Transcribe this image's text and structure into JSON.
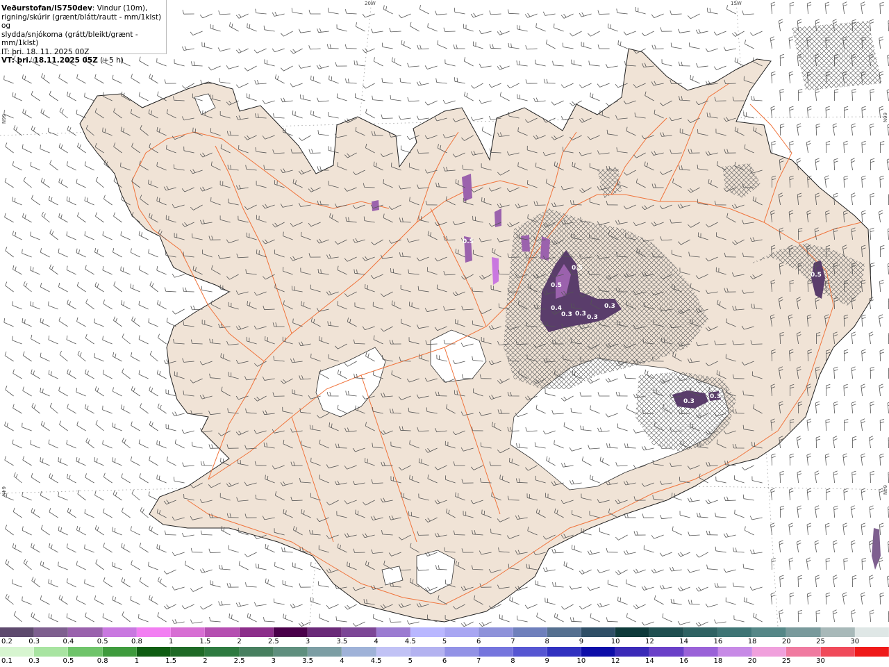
{
  "header": {
    "title": "Veðurstofan/IS750dev",
    "desc1": ": Vindur (10m),",
    "desc2": "rigning/skúrir (grænt/blátt/rautt - mm/1klst) og",
    "desc3": "slydda/snjókoma (grátt/bleikt/grænt - mm/1klst)",
    "it": "IT: þri. 18. 11. 2025 00Z",
    "vt_label": "VT: þri. 18.11.2025 05Z",
    "vt_offset": " (+5 h)"
  },
  "grid_labels": {
    "lon_20w": "20W",
    "lon_15w": "15W",
    "lat_66n_left": "66N",
    "lat_66n_right": "66N",
    "lat_64n_left": "64N",
    "lat_64n_right": "64N"
  },
  "precip_labels": [
    "0.5",
    "0.5",
    "0.4",
    "0.3",
    "0.3",
    "0.3",
    "0.3",
    "0.5",
    "0.3",
    "0.3",
    "0.5"
  ],
  "colors": {
    "land": "#f0e3d6",
    "roads": "#f0743c",
    "coast": "#222222",
    "wind": "#555555",
    "precip_dark": "#5a3d6b",
    "precip_pink": "#e06ce6"
  },
  "snow_scale": {
    "labels": [
      "0.2",
      "0.3",
      "0.4",
      "0.5",
      "0.8",
      "1",
      "1.5",
      "2",
      "2.5",
      "3",
      "3.5",
      "4",
      "4.5",
      "5",
      "6",
      "7",
      "8",
      "9",
      "10",
      "12",
      "14",
      "16",
      "18",
      "20",
      "25",
      "30"
    ],
    "colors": [
      "#5e4a6e",
      "#7e5f8f",
      "#9a62ad",
      "#c978e0",
      "#f27ff2",
      "#d76ed3",
      "#b54fb1",
      "#8c2e8a",
      "#4a004a",
      "#6a2a78",
      "#7c4696",
      "#9b7bd1",
      "#b9b7ff",
      "#a8a6f2",
      "#8e92da",
      "#6f80bc",
      "#557090",
      "#2f4f66",
      "#0e3a3a",
      "#1f4f50",
      "#2f6363",
      "#3e7575",
      "#558787",
      "#799a9c",
      "#a8b9b9",
      "#dfe7e6"
    ]
  },
  "rain_scale": {
    "labels": [
      "0.1",
      "0.3",
      "0.5",
      "0.8",
      "1",
      "1.5",
      "2",
      "2.5",
      "3",
      "3.5",
      "4",
      "4.5",
      "5",
      "6",
      "7",
      "8",
      "9",
      "10",
      "12",
      "14",
      "16",
      "18",
      "20",
      "25",
      "30"
    ],
    "colors": [
      "#d7f5d0",
      "#a8e4a1",
      "#6fc46a",
      "#3f9b3d",
      "#0f5d12",
      "#1f6a26",
      "#2e7a40",
      "#477f5f",
      "#5f8f7e",
      "#7c9ea4",
      "#9fb2d8",
      "#c1c2f5",
      "#b3b2f0",
      "#9292e6",
      "#7575dd",
      "#5656d2",
      "#3131c0",
      "#0d0da8",
      "#3b2ab8",
      "#6a40c8",
      "#9a62d8",
      "#c78ae6",
      "#f0a0dc",
      "#f07aa0",
      "#f04a5a",
      "#ef1a1a"
    ]
  }
}
